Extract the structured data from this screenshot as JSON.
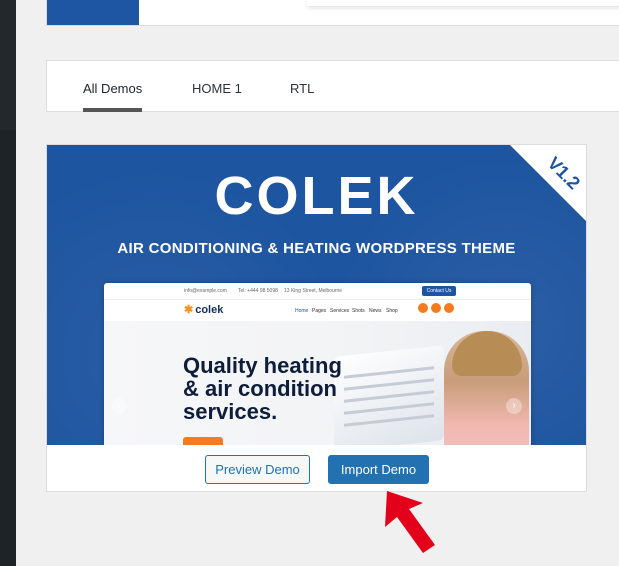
{
  "tabs": [
    {
      "label": "All Demos",
      "active": true
    },
    {
      "label": "HOME 1",
      "active": false
    },
    {
      "label": "RTL",
      "active": false
    }
  ],
  "demo": {
    "brand": "COLEK",
    "tagline": "AIR CONDITIONING & HEATING WORDPRESS THEME",
    "version_badge": "V1.2",
    "mock_site": {
      "email": "info@example.com",
      "phone": "Tel: +444 98 5098",
      "address": "13 King Street, Melbourne",
      "contact_button": "Contact Us",
      "logo": "colek",
      "menu": [
        "Home",
        "Pages",
        "Services",
        "Shots",
        "News",
        "Shop"
      ],
      "hero_line1": "Quality heating",
      "hero_line2": "& air condition",
      "hero_line3": "services."
    }
  },
  "buttons": {
    "preview_label": "Preview Demo",
    "import_label": "Import Demo"
  },
  "colors": {
    "accent": "#2271b1",
    "brand_blue": "#1e55a0",
    "pointer_red": "#e3001b"
  }
}
